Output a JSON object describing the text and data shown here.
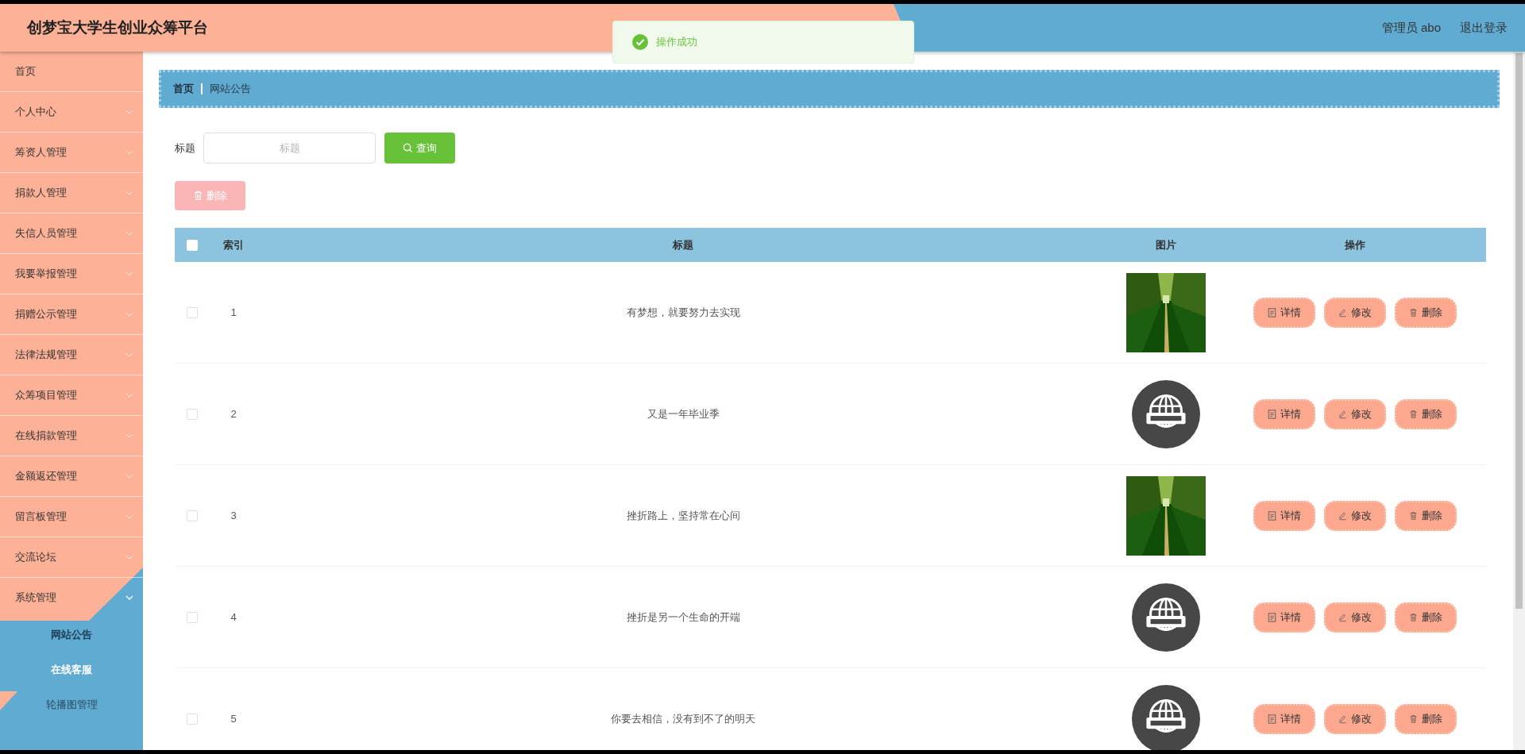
{
  "header": {
    "title": "创梦宝大学生创业众筹平台",
    "user": "管理员 abo",
    "logout": "退出登录"
  },
  "toast": {
    "message": "操作成功"
  },
  "sidebar": {
    "items": [
      {
        "label": "首页",
        "kind": "link"
      },
      {
        "label": "个人中心",
        "kind": "submenu",
        "expanded": false
      },
      {
        "label": "筹资人管理",
        "kind": "submenu",
        "expanded": false
      },
      {
        "label": "捐款人管理",
        "kind": "submenu",
        "expanded": false
      },
      {
        "label": "失信人员管理",
        "kind": "submenu",
        "expanded": false
      },
      {
        "label": "我要举报管理",
        "kind": "submenu",
        "expanded": false
      },
      {
        "label": "捐赠公示管理",
        "kind": "submenu",
        "expanded": false
      },
      {
        "label": "法律法规管理",
        "kind": "submenu",
        "expanded": false
      },
      {
        "label": "众筹项目管理",
        "kind": "submenu",
        "expanded": false
      },
      {
        "label": "在线捐款管理",
        "kind": "submenu",
        "expanded": false
      },
      {
        "label": "金额返还管理",
        "kind": "submenu",
        "expanded": false
      },
      {
        "label": "留言板管理",
        "kind": "submenu",
        "expanded": false
      },
      {
        "label": "交流论坛",
        "kind": "submenu",
        "expanded": false
      },
      {
        "label": "系统管理",
        "kind": "submenu",
        "expanded": true,
        "children": [
          {
            "label": "网站公告",
            "selected": true,
            "hovered": false
          },
          {
            "label": "在线客服",
            "selected": false,
            "hovered": true
          },
          {
            "label": "轮播图管理",
            "selected": false,
            "hovered": false
          }
        ]
      }
    ]
  },
  "breadcrumb": [
    "首页",
    "网站公告"
  ],
  "search": {
    "label": "标题",
    "placeholder": "标题",
    "button": "查询"
  },
  "delete_button": {
    "label": "删除",
    "disabled": true
  },
  "table": {
    "columns": [
      "索引",
      "标题",
      "图片",
      "操作"
    ],
    "all_checked": false,
    "rows": [
      {
        "index": "1",
        "title": "有梦想，就要努力去实现",
        "kind": "picture",
        "checked": false,
        "actions": [
          {
            "kind": "detail",
            "label": "详情"
          },
          {
            "kind": "edit",
            "label": "修改"
          },
          {
            "kind": "delete",
            "label": "删除"
          }
        ]
      },
      {
        "index": "2",
        "title": "又是一年毕业季",
        "kind": "icon",
        "checked": false,
        "actions": [
          {
            "kind": "detail",
            "label": "详情"
          },
          {
            "kind": "edit",
            "label": "修改"
          },
          {
            "kind": "delete",
            "label": "删除"
          }
        ]
      },
      {
        "index": "3",
        "title": "挫折路上，坚持常在心间",
        "kind": "picture",
        "checked": false,
        "actions": [
          {
            "kind": "detail",
            "label": "详情"
          },
          {
            "kind": "edit",
            "label": "修改"
          },
          {
            "kind": "delete",
            "label": "删除"
          }
        ]
      },
      {
        "index": "4",
        "title": "挫折是另一个生命的开端",
        "kind": "icon",
        "checked": false,
        "actions": [
          {
            "kind": "detail",
            "label": "详情"
          },
          {
            "kind": "edit",
            "label": "修改"
          },
          {
            "kind": "delete",
            "label": "删除"
          }
        ]
      },
      {
        "index": "5",
        "title": "你要去相信，没有到不了的明天",
        "kind": "icon",
        "checked": false,
        "actions": [
          {
            "kind": "detail",
            "label": "详情"
          },
          {
            "kind": "edit",
            "label": "修改"
          },
          {
            "kind": "delete",
            "label": "删除"
          }
        ]
      }
    ]
  }
}
